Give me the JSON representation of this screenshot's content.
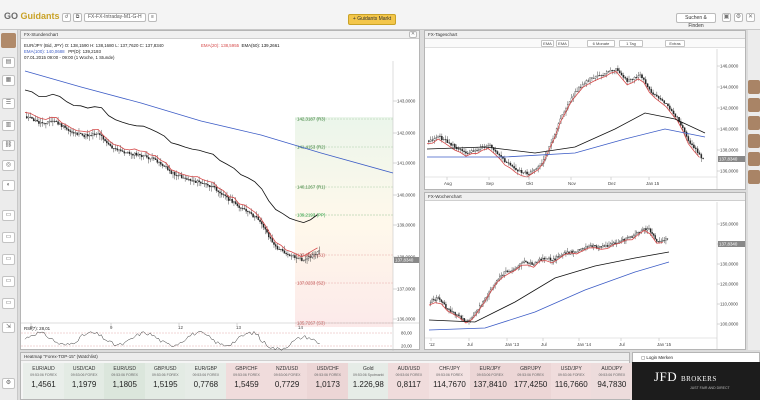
{
  "topbar": {
    "logo_prefix": "GO",
    "logo_text": "Guidants",
    "workspace": "FX-FX-Intraday-M1-G-H",
    "center_button": "Guidants Markt",
    "search_button": "Suchen & Finden"
  },
  "hourly": {
    "title": "FX-Stundenchart",
    "line1_prefix": "EUR/JPY (Bid, JPY)",
    "line1_values": "O: 138,1590 H: 138,1680 L: 137,7620 C: 137,8340",
    "ema20": "EMA(20): 138,5955",
    "ema50": "EMA(50): 139,2661",
    "ema100": "EMA(100): 140,0688",
    "pivot": "PP(D): 139,2193",
    "range": "07.01.2015 09:00 - 09:00 (1 Woche, 1 Stunde)",
    "fib_labels": [
      "142,3187 (R3)",
      "141,4153 (R2)",
      "140,1267 (R1)",
      "139,2193 (PP)",
      "137,9201 (S1)",
      "137,0233 (S2)",
      "135,7267 (S3)"
    ],
    "y_ticks": [
      "143,0000",
      "142,0000",
      "141,0000",
      "140,0000",
      "139,0000",
      "138,0000",
      "137,0000",
      "136,0000"
    ],
    "last_price": "137,8340",
    "x_ticks": [
      "8",
      "9",
      "12",
      "13",
      "14"
    ],
    "rsi_label": "RSI(7): 28,01",
    "rsi_ticks": [
      "80,00",
      "20,00"
    ]
  },
  "daily": {
    "title": "FX-Tageschart",
    "line1_prefix": "EUR/JPY (Bid, JPY)",
    "line1_values": "O: 138,8370 H: 138,9030 L: 137,6400 C: 137,8340",
    "range": "14.07.2014 - 14.01.2015 (6 Monate, 1 Tag)",
    "ema20": "EMA(20): 142,4710",
    "ema50": "EMA(50): 143,7204",
    "ema100": "EMA(100): 142,7779",
    "toolbar": [
      "EMA",
      "EMA",
      "6 Monate",
      "1 Tag",
      "Extras"
    ],
    "y_ticks": [
      "146,0000",
      "144,0000",
      "142,0000",
      "140,0000",
      "138,0000",
      "136,0000"
    ],
    "last_price": "137,8340",
    "x_ticks": [
      "Aug",
      "Sep",
      "Okt",
      "Nov",
      "Dez",
      "Jan 15"
    ]
  },
  "weekly": {
    "title": "FX-Wochenchart",
    "line1_prefix": "EUR/JPY (Bid, JPY)",
    "line1_values": "O: 140,3960 H: 140,6690 L: 137,6100 C: 137,8340",
    "range": "09.01.2012 - 12.01.2015 (3 Jahre, 1 Woche)",
    "ema20": "EMA(20): 142,2700",
    "ema50": "EMA(50): 139,8019",
    "ema100": "EMA(100): 134,7825",
    "y_ticks": [
      "150,0000",
      "140,0000",
      "130,0000",
      "120,0000",
      "110,0000",
      "100,0000"
    ],
    "last_price": "137,8340",
    "x_ticks": [
      "'12",
      "Jul",
      "Jan '13",
      "Jul",
      "Jan '14",
      "Jul",
      "Jan '15"
    ]
  },
  "watchlist": {
    "title": "Heatmap \"Forex-TOP-15\" (Watchlist)",
    "tiles": [
      {
        "sym": "EUR/AUD",
        "time": "09:53:06 FOREX",
        "val": "1,4561",
        "color": "#e9eeea"
      },
      {
        "sym": "USD/CAD",
        "time": "09:53:06 FOREX",
        "val": "1,1979",
        "color": "#e3ebe4"
      },
      {
        "sym": "EUR/USD",
        "time": "09:53:06 FOREX",
        "val": "1,1805",
        "color": "#dbe6dc"
      },
      {
        "sym": "GBP/USD",
        "time": "09:53:06 FOREX",
        "val": "1,5195",
        "color": "#e3ebe4"
      },
      {
        "sym": "EUR/GBP",
        "time": "09:53:06 FOREX",
        "val": "0,7768",
        "color": "#e6ece7"
      },
      {
        "sym": "GBP/CHF",
        "time": "09:53:06 FOREX",
        "val": "1,5459",
        "color": "#f0dcdc"
      },
      {
        "sym": "NZD/USD",
        "time": "09:53:06 FOREX",
        "val": "0,7729",
        "color": "#f0dcdc"
      },
      {
        "sym": "USD/CHF",
        "time": "09:53:06 FOREX",
        "val": "1,0173",
        "color": "#ecd6d6"
      },
      {
        "sym": "Gold",
        "time": "09:53:06 Spotmarkt",
        "val": "1.226,98",
        "color": "#e6ece7"
      },
      {
        "sym": "AUD/USD",
        "time": "09:53:06 FOREX",
        "val": "0,8117",
        "color": "#f0dcdc"
      },
      {
        "sym": "CHF/JPY",
        "time": "09:53:06 FOREX",
        "val": "114,7670",
        "color": "#f3e2e2"
      },
      {
        "sym": "EUR/JPY",
        "time": "09:53:06 FOREX",
        "val": "137,8410",
        "color": "#ecd6d6"
      },
      {
        "sym": "GBP/JPY",
        "time": "09:53:06 FOREX",
        "val": "177,4250",
        "color": "#ecd6d6"
      },
      {
        "sym": "USD/JPY",
        "time": "09:53:06 FOREX",
        "val": "116,7660",
        "color": "#f0dcdc"
      },
      {
        "sym": "AUD/JPY",
        "time": "09:53:06 FOREX",
        "val": "94,7830",
        "color": "#eddcdc"
      }
    ]
  },
  "brand": {
    "login_label": "Login Merken",
    "name": "JFD",
    "name_suffix": "BROKERS",
    "tagline": "JUST FAIR AND DIRECT"
  },
  "colors": {
    "ema20": "#d64a4a",
    "ema50": "#111111",
    "ema100": "#3c5cc6",
    "pivot_green": "#1f9a3a",
    "accent": "#f3c64a"
  }
}
